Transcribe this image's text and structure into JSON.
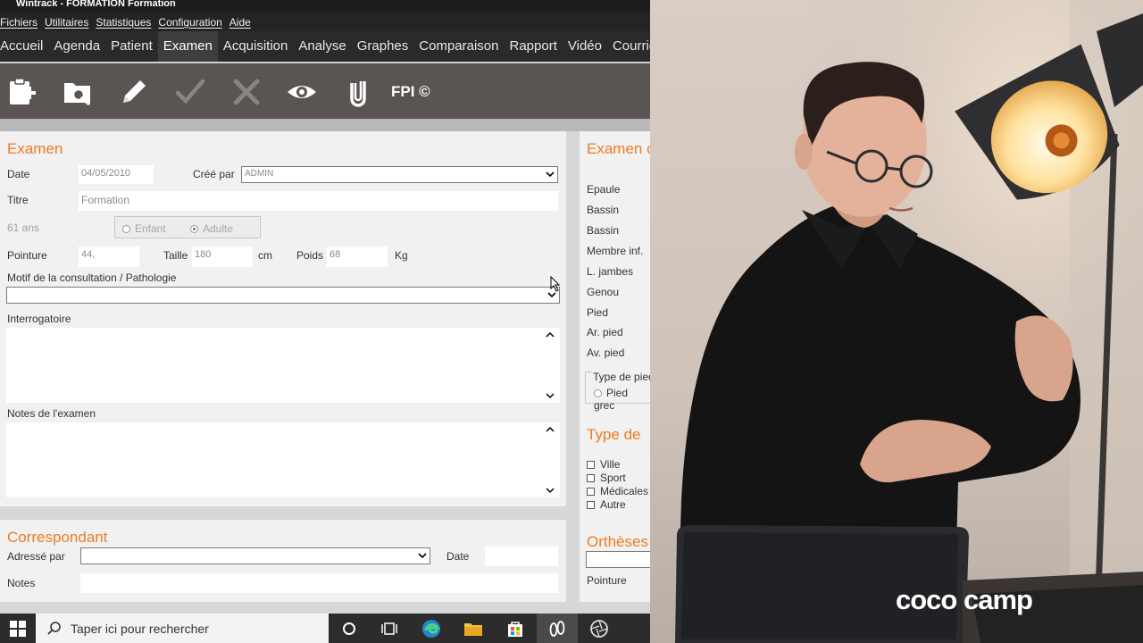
{
  "window": {
    "title": "Wintrack - FORMATION Formation"
  },
  "menu": [
    "Fichiers",
    "Utilitaires",
    "Statistiques",
    "Configuration",
    "Aide"
  ],
  "module_tabs": [
    {
      "label": "Accueil",
      "active": false
    },
    {
      "label": "Agenda",
      "active": false
    },
    {
      "label": "Patient",
      "active": false
    },
    {
      "label": "Examen",
      "active": true
    },
    {
      "label": "Acquisition",
      "active": false
    },
    {
      "label": "Analyse",
      "active": false
    },
    {
      "label": "Graphes",
      "active": false
    },
    {
      "label": "Comparaison",
      "active": false
    },
    {
      "label": "Rapport",
      "active": false
    },
    {
      "label": "Vidéo",
      "active": false
    },
    {
      "label": "Courrie",
      "active": false
    }
  ],
  "toolbar": {
    "icons": [
      "new-document-icon",
      "preview-search-icon",
      "edit-pencil-icon",
      "validate-check-icon",
      "cancel-x-icon",
      "view-eye-icon",
      "attachment-clip-icon"
    ],
    "fpi_label": "FPI ©"
  },
  "examen": {
    "title": "Examen",
    "date_label": "Date",
    "date_value": "04/05/2010",
    "cree_par_label": "Créé par",
    "cree_par_value": "ADMIN",
    "titre_label": "Titre",
    "titre_value": "Formation",
    "age_label": "61 ans",
    "radio_enfant": "Enfant",
    "radio_adulte": "Adulte",
    "pointure_label": "Pointure",
    "pointure_value": "44,",
    "taille_label": "Taille",
    "taille_value": "180",
    "taille_unit": "cm",
    "poids_label": "Poids",
    "poids_value": "68",
    "poids_unit": "Kg",
    "motif_label": "Motif de la consultation / Pathologie",
    "interrogatoire_label": "Interrogatoire",
    "notes_label": "Notes de l'examen"
  },
  "correspondant": {
    "title": "Correspondant",
    "adresse_label": "Adressé par",
    "date_label": "Date",
    "notes_label": "Notes"
  },
  "examen_right": {
    "title": "Examen c",
    "body_parts": [
      "Epaule",
      "Bassin",
      "Bassin",
      "Membre inf.",
      "L. jambes",
      "Genou",
      "Pied",
      "Ar. pied",
      "Av. pied"
    ],
    "type_pied_label": "Type de pied",
    "type_pied_option": "Pied grec",
    "type_de_title": "Type de",
    "checkboxes": [
      "Ville",
      "Sport",
      "Médicales",
      "Autre"
    ],
    "ortheses_title": "Orthèses",
    "pointure_label": "Pointure"
  },
  "taskbar": {
    "search_placeholder": "Taper ici pour rechercher",
    "icons": [
      "windows-start-icon",
      "search-icon",
      "cortana-circle-icon",
      "task-view-icon",
      "edge-browser-icon",
      "file-explorer-icon",
      "store-icon",
      "wintrack-feet-icon",
      "camera-app-icon"
    ]
  },
  "watermark": "coco camp"
}
